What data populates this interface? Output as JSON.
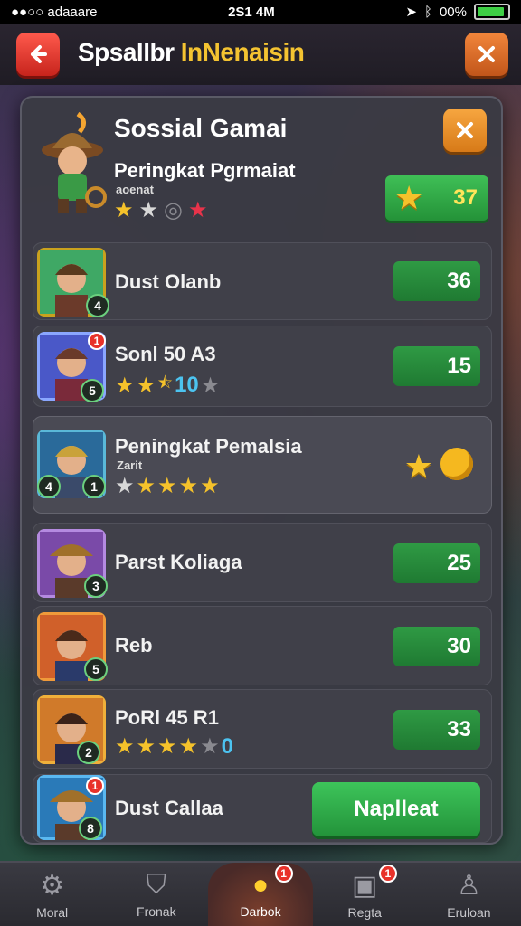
{
  "status_bar": {
    "carrier": "●●○○ adaaare",
    "time": "2S1 4M",
    "battery_text": "00%",
    "icons": [
      "location-icon",
      "bluetooth-icon",
      "battery-icon"
    ]
  },
  "header": {
    "title_part1": "Spsallbr",
    "title_part2": "InNenaisin",
    "back_icon": "back-arrow-icon",
    "close_icon": "close-icon"
  },
  "panel": {
    "title": "Sossial  Gamai",
    "subtitle": "Peringkat Pgrmaiat",
    "small": "aoenat",
    "score": "37",
    "close_icon": "close-icon"
  },
  "rows": [
    {
      "name": "Dust Olanb",
      "level": "4",
      "score": "36"
    },
    {
      "name": "Sonl 50 A3",
      "level": "5",
      "score": "15",
      "stars_count": "10",
      "notif": "1"
    },
    {
      "name": "Peningkat Pemalsia",
      "sub": "Zarit",
      "level": "1",
      "level2": "4"
    },
    {
      "name": "Parst Koliaga",
      "level": "3",
      "score": "25"
    },
    {
      "name": "Reb",
      "level": "5",
      "score": "30"
    },
    {
      "name": "PoRl 45 R1",
      "level": "2",
      "score": "33",
      "stars_count": "0"
    },
    {
      "name": "Dust Callaa",
      "level": "8",
      "notif": "1",
      "action": "Naplleat"
    }
  ],
  "bottom_nav": [
    {
      "label": "Moral",
      "icon": "gear-house-icon"
    },
    {
      "label": "Fronak",
      "icon": "shield-icon"
    },
    {
      "label": "Darbok",
      "icon": "chat-bubble-icon",
      "notif": "1",
      "active": true
    },
    {
      "label": "Regta",
      "icon": "gift-box-icon",
      "notif": "1"
    },
    {
      "label": "Eruloan",
      "icon": "person-icon"
    }
  ],
  "colors": {
    "accent_green": "#2f9a44",
    "accent_gold": "#f5c22b",
    "back_red": "#e0342a",
    "close_orange": "#e07a2a"
  }
}
